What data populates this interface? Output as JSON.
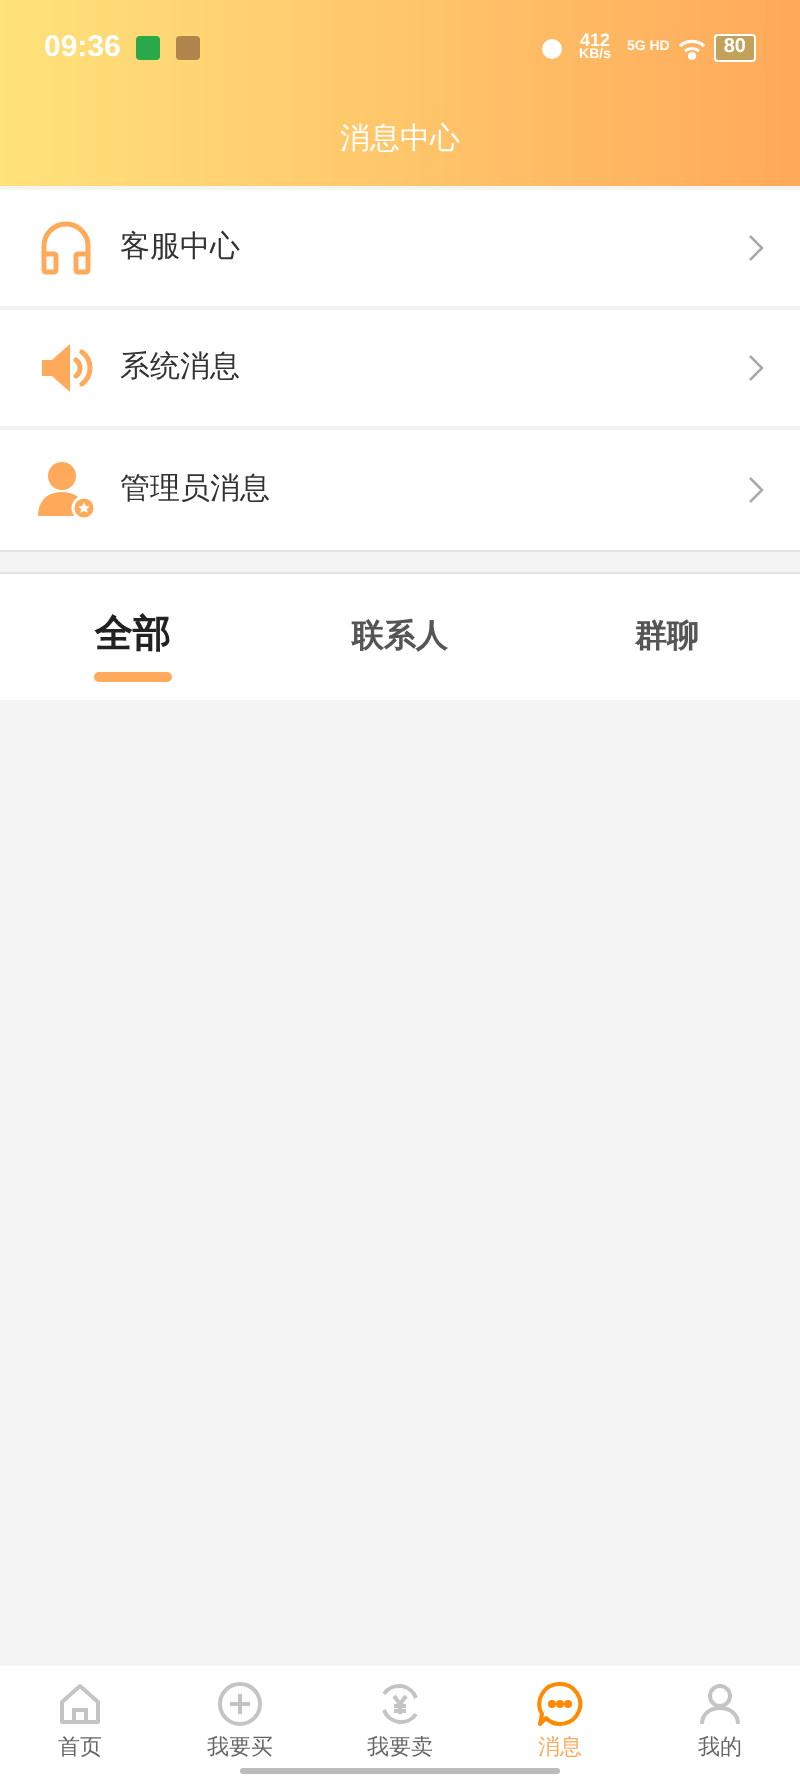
{
  "status_bar": {
    "time": "09:36",
    "speed": "412",
    "speed_unit": "KB/s",
    "network": "5G HD",
    "battery": "80"
  },
  "title": "消息中心",
  "menu": [
    {
      "kind": "headset",
      "label": "客服中心"
    },
    {
      "kind": "speaker",
      "label": "系统消息"
    },
    {
      "kind": "admin",
      "label": "管理员消息"
    }
  ],
  "tabs": [
    {
      "label": "全部",
      "selected": true
    },
    {
      "label": "联系人",
      "selected": false
    },
    {
      "label": "群聊",
      "selected": false
    }
  ],
  "nav": [
    {
      "kind": "home",
      "label": "首页",
      "selected": false
    },
    {
      "kind": "plus",
      "label": "我要买",
      "selected": false
    },
    {
      "kind": "yen",
      "label": "我要卖",
      "selected": false
    },
    {
      "kind": "chat",
      "label": "消息",
      "selected": true
    },
    {
      "kind": "user",
      "label": "我的",
      "selected": false
    }
  ]
}
